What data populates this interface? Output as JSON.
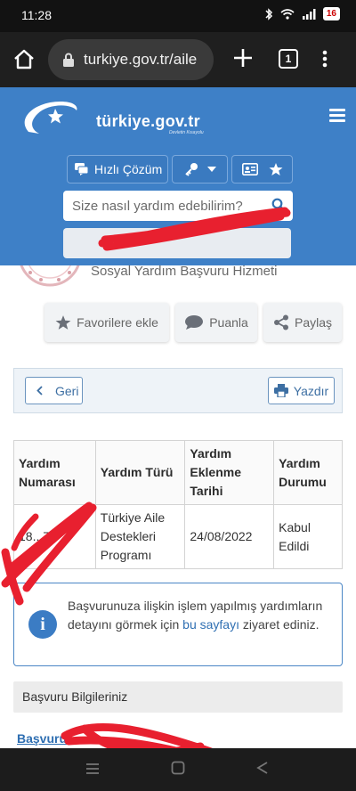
{
  "status": {
    "time": "11:28",
    "battery": "16"
  },
  "browser": {
    "url": "turkiye.gov.tr/aile",
    "tab_count": "1"
  },
  "site": {
    "logo_text": "türkiye.gov.tr",
    "logo_sub": "Devletin Kısayolu"
  },
  "header": {
    "quick_solution_label": "Hızlı Çözüm",
    "search_placeholder": "Size nasıl yardım edebilirim?"
  },
  "page": {
    "title": "Sosyal Yardım Başvuru Hizmeti",
    "actions": {
      "favorite": "Favorilere ekle",
      "rate": "Puanla",
      "share": "Paylaş"
    },
    "back_label": "Geri",
    "print_label": "Yazdır"
  },
  "table": {
    "headers": [
      "Yardım Numarası",
      "Yardım Türü",
      "Yardım Eklenme Tarihi",
      "Yardım Durumu"
    ],
    "rows": [
      {
        "number": "18...79",
        "type": "Türkiye Aile Destekleri Programı",
        "date": "24/08/2022",
        "status": "Kabul Edildi"
      }
    ]
  },
  "info": {
    "text_before": "Başvurunuza ilişkin işlem yapılmış yardımların detayını görmek için ",
    "link": "bu sayfayı",
    "text_after": " ziyaret ediniz."
  },
  "panel": {
    "title": "Başvuru Bilgileriniz",
    "link_label": "Başvuru"
  },
  "colors": {
    "header_blue": "#3e80c7",
    "link_blue": "#2f6fb2",
    "redaction_red": "#e8202f"
  }
}
